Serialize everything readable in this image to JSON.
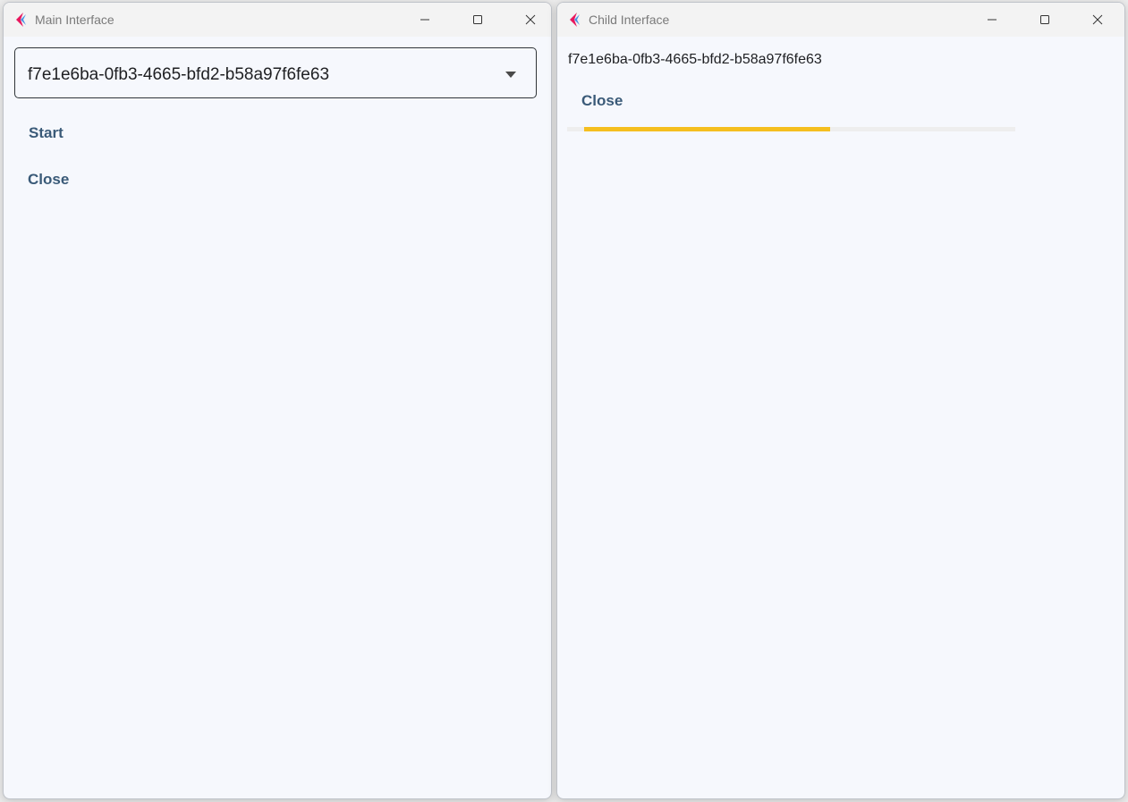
{
  "main_window": {
    "title": "Main Interface",
    "dropdown": {
      "selected_value": "f7e1e6ba-0fb3-4665-bfd2-b58a97f6fe63"
    },
    "start_label": "Start",
    "close_label": "Close",
    "controls": [
      "minimize-icon",
      "maximize-icon",
      "close-icon"
    ]
  },
  "child_window": {
    "title": "Child Interface",
    "id_text": "f7e1e6ba-0fb3-4665-bfd2-b58a97f6fe63",
    "close_label": "Close",
    "progress": {
      "value": 0.57
    },
    "controls": [
      "minimize-icon",
      "maximize-icon",
      "close-icon"
    ]
  },
  "colors": {
    "accent_text": "#3a5a78",
    "progress_fill": "#f5bf1f",
    "progress_track": "#eeeeee",
    "window_bg": "#f6f8fd"
  }
}
